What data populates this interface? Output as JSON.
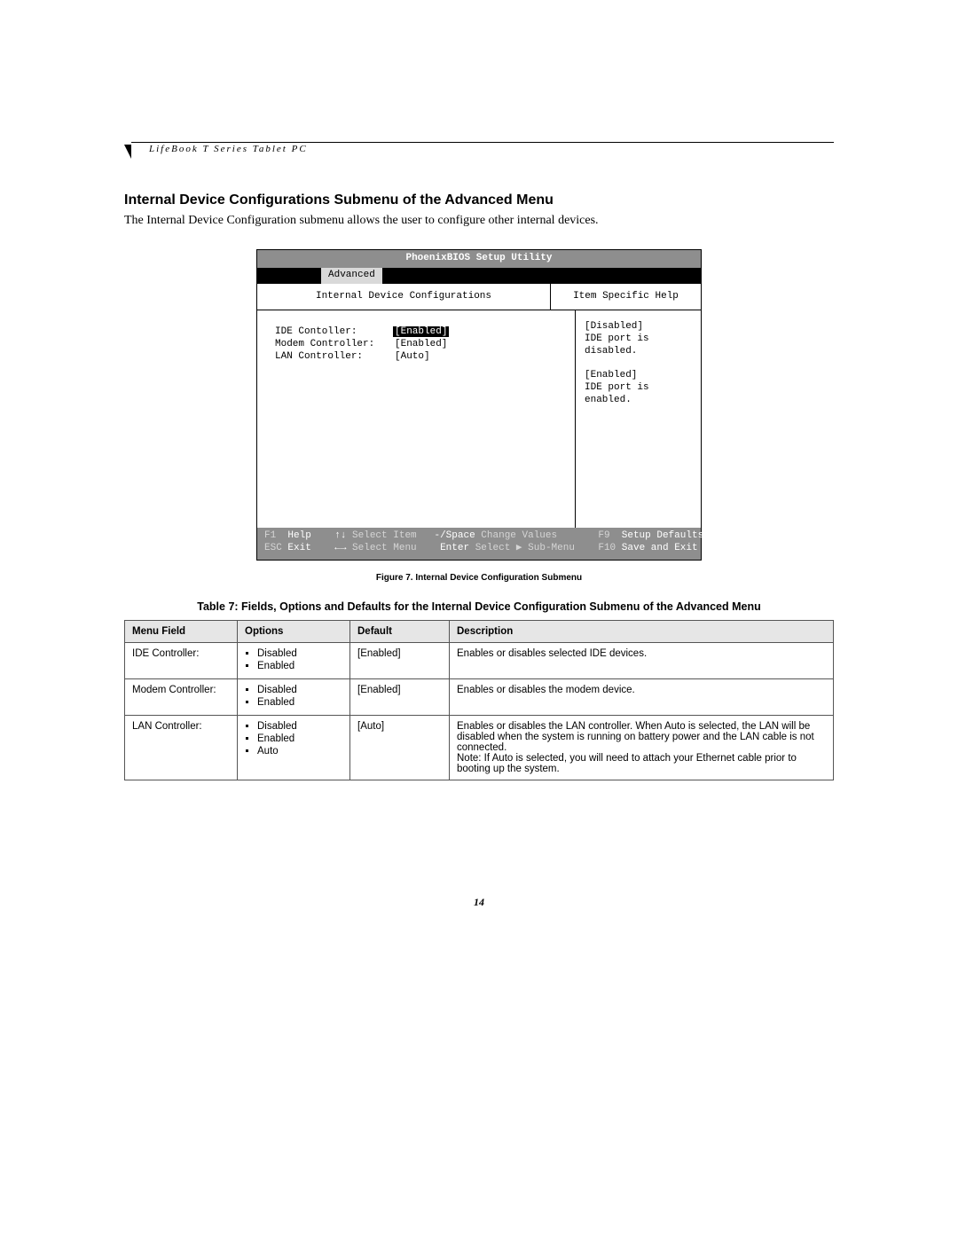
{
  "running_head": "LifeBook T Series Tablet PC",
  "section_title": "Internal Device Configurations Submenu of the Advanced Menu",
  "intro_text": "The Internal Device Configuration submenu allows the user to configure other internal devices.",
  "bios": {
    "title": "PhoenixBIOS Setup Utility",
    "active_tab": "Advanced",
    "panel_title": "Internal Device Configurations",
    "help_title": "Item Specific Help",
    "settings": [
      {
        "label": "IDE Contoller:",
        "value": "Enabled",
        "highlighted": true
      },
      {
        "label": "Modem Controller:",
        "value": "[Enabled]",
        "highlighted": false
      },
      {
        "label": "LAN Controller:",
        "value": "[Auto]",
        "highlighted": false
      }
    ],
    "help_lines": [
      "[Disabled]",
      "IDE port is disabled.",
      "",
      "[Enabled]",
      "IDE port is enabled."
    ],
    "footer": {
      "f1": "F1",
      "help": "Help",
      "arrows_ud": "↑↓",
      "select_item": "Select Item",
      "minus_space": "-/Space",
      "change_values": "Change Values",
      "f9": "F9",
      "setup_defaults": "Setup Defaults",
      "esc": "ESC",
      "exit": "Exit",
      "arrows_lr": "←→",
      "select_menu": "Select Menu",
      "enter": "Enter",
      "select_submenu": "Select ▶ Sub-Menu",
      "f10": "F10",
      "save_exit": "Save and Exit"
    }
  },
  "figure_caption": "Figure 7.   Internal Device Configuration Submenu",
  "table_caption": "Table 7: Fields, Options and Defaults for the Internal Device Configuration Submenu of the Advanced Menu",
  "table_headers": {
    "menu": "Menu Field",
    "options": "Options",
    "default": "Default",
    "description": "Description"
  },
  "table_rows": [
    {
      "menu": "IDE Controller:",
      "options": [
        "Disabled",
        "Enabled"
      ],
      "default": "[Enabled]",
      "description": "Enables or disables selected IDE devices."
    },
    {
      "menu": "Modem Controller:",
      "options": [
        "Disabled",
        "Enabled"
      ],
      "default": "[Enabled]",
      "description": "Enables or disables the modem device."
    },
    {
      "menu": "LAN Controller:",
      "options": [
        "Disabled",
        "Enabled",
        "Auto"
      ],
      "default": "[Auto]",
      "description": "Enables or disables the LAN controller. When Auto is selected, the LAN will be disabled when the system is running on battery power and the LAN cable is not connected.\nNote: If Auto is selected, you will need to attach your Ethernet cable prior to booting up the system."
    }
  ],
  "page_number": "14"
}
